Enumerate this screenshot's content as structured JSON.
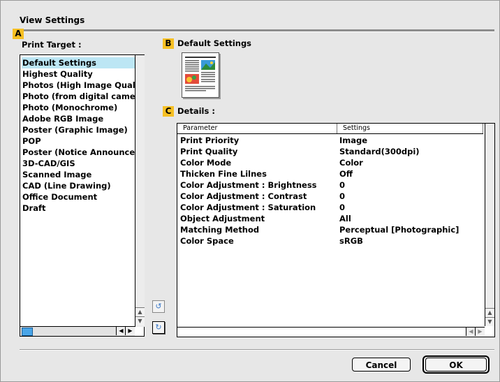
{
  "window": {
    "title": "View Settings"
  },
  "badges": {
    "a": "A",
    "b": "B",
    "c": "C"
  },
  "print_target": {
    "label": "Print Target :",
    "items": [
      "Default Settings",
      "Highest Quality",
      "Photos (High Image Quali",
      "Photo (from digital camer",
      "Photo (Monochrome)",
      "Adobe RGB Image",
      "Poster (Graphic Image)",
      "POP",
      "Poster (Notice Announcen",
      "3D-CAD/GIS",
      "Scanned Image",
      "CAD (Line Drawing)",
      "Office Document",
      "Draft"
    ],
    "selected_index": 0
  },
  "default_settings": {
    "label": "Default Settings"
  },
  "details": {
    "label": "Details :",
    "columns": [
      "Parameter",
      "Settings"
    ],
    "rows": [
      {
        "parameter": "Print Priority",
        "setting": "Image"
      },
      {
        "parameter": "Print Quality",
        "setting": "Standard(300dpi)"
      },
      {
        "parameter": "Color Mode",
        "setting": "Color"
      },
      {
        "parameter": "Thicken Fine Lilnes",
        "setting": "Off"
      },
      {
        "parameter": "Color Adjustment : Brightness",
        "setting": "0"
      },
      {
        "parameter": "Color Adjustment : Contrast",
        "setting": "0"
      },
      {
        "parameter": "Color Adjustment : Saturation",
        "setting": "0"
      },
      {
        "parameter": "Object Adjustment",
        "setting": "All"
      },
      {
        "parameter": "Matching Method",
        "setting": "Perceptual [Photographic]"
      },
      {
        "parameter": "Color Space",
        "setting": "sRGB"
      }
    ]
  },
  "icons": {
    "scroll_up": "▲",
    "scroll_down": "▼",
    "scroll_left": "◀",
    "scroll_right": "▶",
    "restore": "↺",
    "apply": "↻"
  },
  "buttons": {
    "cancel": "Cancel",
    "ok": "OK"
  },
  "colors": {
    "selection": "#bce6f4",
    "badge": "#f6c024",
    "scroll_thumb": "#49a5e8"
  }
}
